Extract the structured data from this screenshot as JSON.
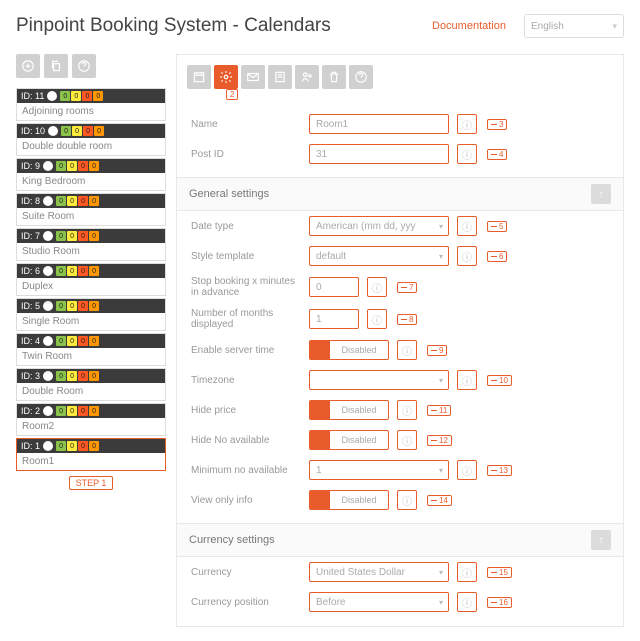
{
  "header": {
    "title": "Pinpoint Booking System - Calendars",
    "doc_link": "Documentation",
    "language": "English"
  },
  "sidebar": {
    "items": [
      {
        "id": "ID: 11",
        "name": "Adjoining rooms"
      },
      {
        "id": "ID: 10",
        "name": "Double double room"
      },
      {
        "id": "ID: 9",
        "name": "King Bedroom"
      },
      {
        "id": "ID: 8",
        "name": "Suite Room"
      },
      {
        "id": "ID: 7",
        "name": "Studio Room"
      },
      {
        "id": "ID: 6",
        "name": "Duplex"
      },
      {
        "id": "ID: 5",
        "name": "Single Room"
      },
      {
        "id": "ID: 4",
        "name": "Twin Room"
      },
      {
        "id": "ID: 3",
        "name": "Double Room"
      },
      {
        "id": "ID: 2",
        "name": "Room2"
      },
      {
        "id": "ID: 1",
        "name": "Room1"
      }
    ],
    "step_label": "STEP 1",
    "dot_value": "0"
  },
  "tabs": {
    "callout": "2"
  },
  "basic": {
    "name_label": "Name",
    "name_value": "Room1",
    "name_callout": "3",
    "postid_label": "Post ID",
    "postid_value": "31",
    "postid_callout": "4"
  },
  "general": {
    "heading": "General settings",
    "date_type_label": "Date type",
    "date_type_value": "American (mm dd, yyy",
    "date_type_callout": "5",
    "style_label": "Style template",
    "style_value": "default",
    "style_callout": "6",
    "stop_label": "Stop booking x minutes in advance",
    "stop_value": "0",
    "stop_callout": "7",
    "months_label": "Number of months displayed",
    "months_value": "1",
    "months_callout": "8",
    "server_label": "Enable server time",
    "server_value": "Disabled",
    "server_callout": "9",
    "timezone_label": "Timezone",
    "timezone_value": "",
    "timezone_callout": "10",
    "hideprice_label": "Hide price",
    "hideprice_value": "Disabled",
    "hideprice_callout": "11",
    "hideavail_label": "Hide No available",
    "hideavail_value": "Disabled",
    "hideavail_callout": "12",
    "minavail_label": "Minimum no available",
    "minavail_value": "1",
    "minavail_callout": "13",
    "viewonly_label": "View only info",
    "viewonly_value": "Disabled",
    "viewonly_callout": "14"
  },
  "currency": {
    "heading": "Currency settings",
    "currency_label": "Currency",
    "currency_value": "United States Dollar",
    "currency_callout": "15",
    "position_label": "Currency position",
    "position_value": "Before",
    "position_callout": "16"
  }
}
